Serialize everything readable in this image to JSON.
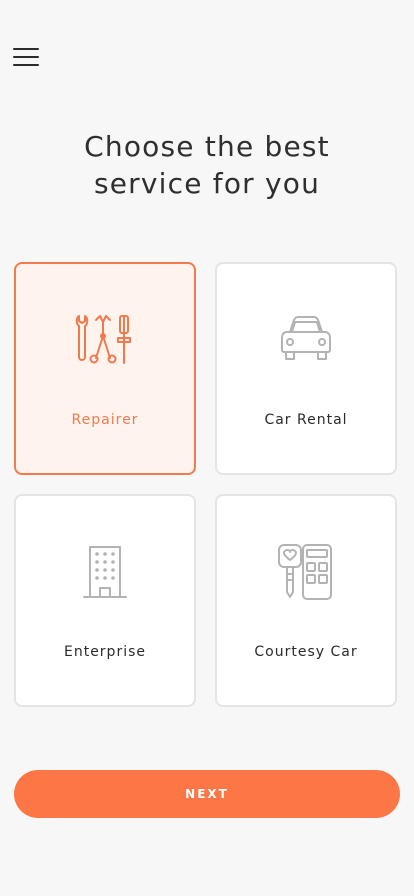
{
  "header": {
    "menu_icon": "hamburger-menu-icon",
    "title_line1": "Choose the best",
    "title_line2": "service for you"
  },
  "services": [
    {
      "label": "Repairer",
      "icon": "tools-icon",
      "selected": true
    },
    {
      "label": "Car Rental",
      "icon": "car-icon",
      "selected": false
    },
    {
      "label": "Enterprise",
      "icon": "building-icon",
      "selected": false
    },
    {
      "label": "Courtesy Car",
      "icon": "car-key-icon",
      "selected": false
    }
  ],
  "footer": {
    "next_label": "NEXT"
  },
  "colors": {
    "accent": "#fd7645",
    "selected_border": "#f37a4c",
    "selected_background": "#fff3ee",
    "icon_inactive": "#b3b3b3",
    "card_border": "#e4e4e6",
    "background": "#f7f7f8"
  }
}
